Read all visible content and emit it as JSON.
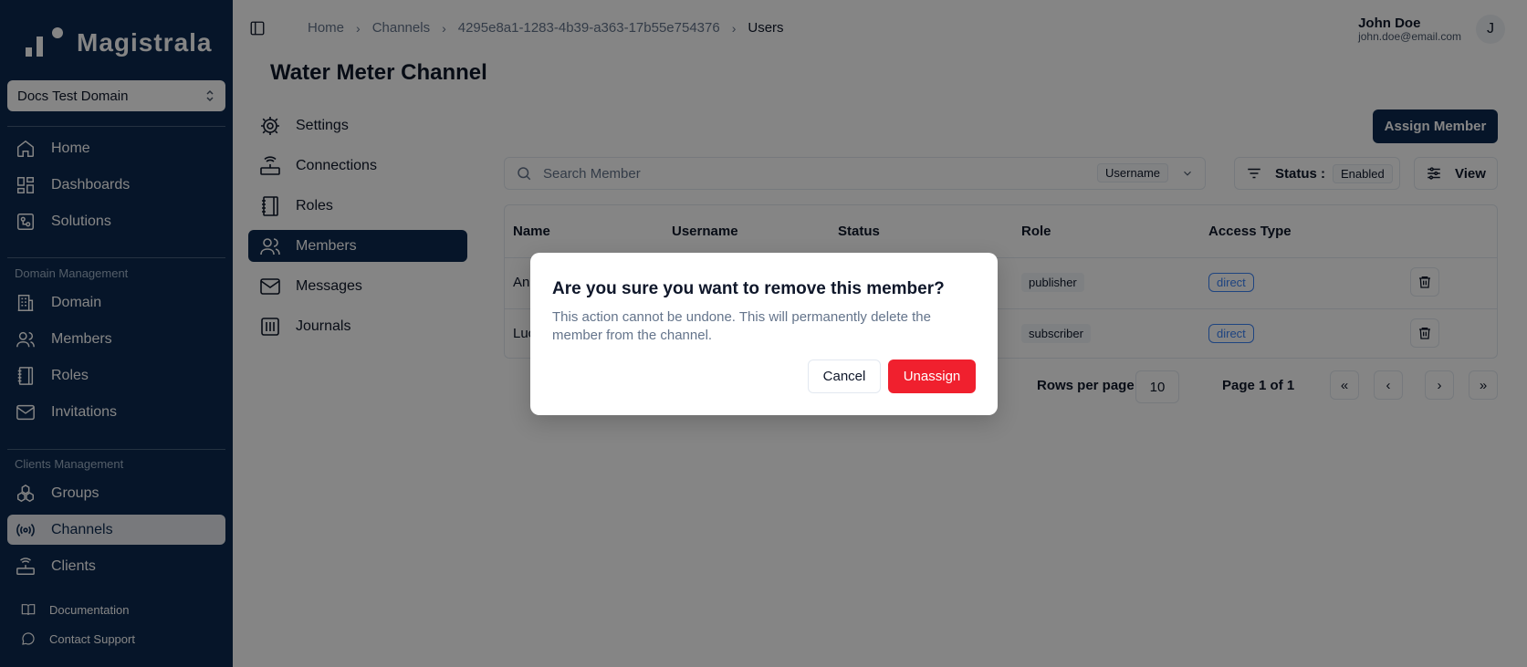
{
  "app": {
    "logo_text": "Magistrala"
  },
  "domain_selector": {
    "value": "Docs Test Domain"
  },
  "sidebar": {
    "main_items": [
      {
        "label": "Home",
        "icon": "home-icon"
      },
      {
        "label": "Dashboards",
        "icon": "dashboard-icon"
      },
      {
        "label": "Solutions",
        "icon": "solutions-icon"
      }
    ],
    "domain_section_label": "Domain Management",
    "domain_items": [
      {
        "label": "Domain",
        "icon": "building-icon"
      },
      {
        "label": "Members",
        "icon": "users-icon"
      },
      {
        "label": "Roles",
        "icon": "notebook-icon"
      },
      {
        "label": "Invitations",
        "icon": "mail-icon"
      }
    ],
    "clients_section_label": "Clients Management",
    "clients_items": [
      {
        "label": "Groups",
        "icon": "groups-icon"
      },
      {
        "label": "Channels",
        "icon": "radio-icon",
        "active": true
      },
      {
        "label": "Clients",
        "icon": "router-icon"
      }
    ],
    "footer_items": [
      {
        "label": "Documentation",
        "icon": "book-icon"
      },
      {
        "label": "Contact Support",
        "icon": "chat-icon"
      }
    ]
  },
  "header": {
    "breadcrumb": [
      "Home",
      "Channels",
      "4295e8a1-1283-4b39-a363-17b55e754376",
      "Users"
    ],
    "user_name": "John Doe",
    "user_email": "john.doe@email.com",
    "avatar_initial": "J"
  },
  "page": {
    "title": "Water Meter Channel"
  },
  "subnav": [
    {
      "label": "Settings",
      "icon": "settings-icon"
    },
    {
      "label": "Connections",
      "icon": "router-icon"
    },
    {
      "label": "Roles",
      "icon": "notebook-icon"
    },
    {
      "label": "Members",
      "icon": "users-icon",
      "active": true
    },
    {
      "label": "Messages",
      "icon": "mail-icon"
    },
    {
      "label": "Journals",
      "icon": "journal-icon"
    }
  ],
  "toolbar": {
    "assign_label": "Assign Member",
    "search_placeholder": "Search Member",
    "search_by": "Username",
    "status_label": "Status :",
    "status_value": "Enabled",
    "view_label": "View"
  },
  "table": {
    "headers": [
      "Name",
      "Username",
      "Status",
      "Role",
      "Access Type"
    ],
    "rows": [
      {
        "name": "And",
        "role": "publisher",
        "access": "direct"
      },
      {
        "name": "Luc",
        "role": "subscriber",
        "access": "direct"
      }
    ]
  },
  "pagination": {
    "rows_label": "Rows per page",
    "rows_value": "10",
    "page_info": "Page 1 of 1",
    "first": "«",
    "prev": "‹",
    "next": "›",
    "last": "»"
  },
  "dialog": {
    "title": "Are you sure you want to remove this member?",
    "description": "This action cannot be undone. This will permanently delete the member from the channel.",
    "cancel_label": "Cancel",
    "confirm_label": "Unassign"
  },
  "colors": {
    "sidebar": "#0d2a4f",
    "danger": "#f0202e",
    "accent": "#3b82f6"
  }
}
